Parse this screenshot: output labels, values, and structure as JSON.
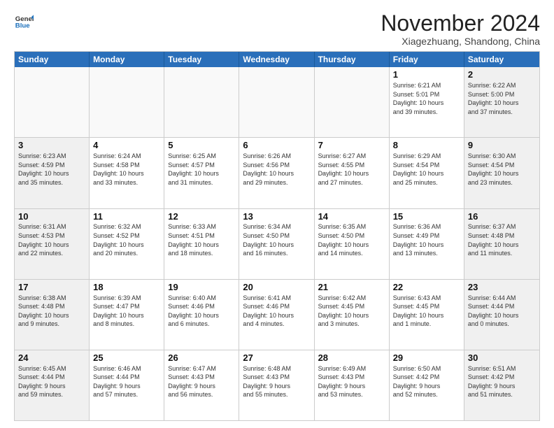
{
  "header": {
    "logo_general": "General",
    "logo_blue": "Blue",
    "month_title": "November 2024",
    "location": "Xiagezhuang, Shandong, China"
  },
  "weekdays": [
    "Sunday",
    "Monday",
    "Tuesday",
    "Wednesday",
    "Thursday",
    "Friday",
    "Saturday"
  ],
  "rows": [
    [
      {
        "day": "",
        "info": "",
        "empty": true
      },
      {
        "day": "",
        "info": "",
        "empty": true
      },
      {
        "day": "",
        "info": "",
        "empty": true
      },
      {
        "day": "",
        "info": "",
        "empty": true
      },
      {
        "day": "",
        "info": "",
        "empty": true
      },
      {
        "day": "1",
        "info": "Sunrise: 6:21 AM\nSunset: 5:01 PM\nDaylight: 10 hours\nand 39 minutes."
      },
      {
        "day": "2",
        "info": "Sunrise: 6:22 AM\nSunset: 5:00 PM\nDaylight: 10 hours\nand 37 minutes."
      }
    ],
    [
      {
        "day": "3",
        "info": "Sunrise: 6:23 AM\nSunset: 4:59 PM\nDaylight: 10 hours\nand 35 minutes."
      },
      {
        "day": "4",
        "info": "Sunrise: 6:24 AM\nSunset: 4:58 PM\nDaylight: 10 hours\nand 33 minutes."
      },
      {
        "day": "5",
        "info": "Sunrise: 6:25 AM\nSunset: 4:57 PM\nDaylight: 10 hours\nand 31 minutes."
      },
      {
        "day": "6",
        "info": "Sunrise: 6:26 AM\nSunset: 4:56 PM\nDaylight: 10 hours\nand 29 minutes."
      },
      {
        "day": "7",
        "info": "Sunrise: 6:27 AM\nSunset: 4:55 PM\nDaylight: 10 hours\nand 27 minutes."
      },
      {
        "day": "8",
        "info": "Sunrise: 6:29 AM\nSunset: 4:54 PM\nDaylight: 10 hours\nand 25 minutes."
      },
      {
        "day": "9",
        "info": "Sunrise: 6:30 AM\nSunset: 4:54 PM\nDaylight: 10 hours\nand 23 minutes."
      }
    ],
    [
      {
        "day": "10",
        "info": "Sunrise: 6:31 AM\nSunset: 4:53 PM\nDaylight: 10 hours\nand 22 minutes."
      },
      {
        "day": "11",
        "info": "Sunrise: 6:32 AM\nSunset: 4:52 PM\nDaylight: 10 hours\nand 20 minutes."
      },
      {
        "day": "12",
        "info": "Sunrise: 6:33 AM\nSunset: 4:51 PM\nDaylight: 10 hours\nand 18 minutes."
      },
      {
        "day": "13",
        "info": "Sunrise: 6:34 AM\nSunset: 4:50 PM\nDaylight: 10 hours\nand 16 minutes."
      },
      {
        "day": "14",
        "info": "Sunrise: 6:35 AM\nSunset: 4:50 PM\nDaylight: 10 hours\nand 14 minutes."
      },
      {
        "day": "15",
        "info": "Sunrise: 6:36 AM\nSunset: 4:49 PM\nDaylight: 10 hours\nand 13 minutes."
      },
      {
        "day": "16",
        "info": "Sunrise: 6:37 AM\nSunset: 4:48 PM\nDaylight: 10 hours\nand 11 minutes."
      }
    ],
    [
      {
        "day": "17",
        "info": "Sunrise: 6:38 AM\nSunset: 4:48 PM\nDaylight: 10 hours\nand 9 minutes."
      },
      {
        "day": "18",
        "info": "Sunrise: 6:39 AM\nSunset: 4:47 PM\nDaylight: 10 hours\nand 8 minutes."
      },
      {
        "day": "19",
        "info": "Sunrise: 6:40 AM\nSunset: 4:46 PM\nDaylight: 10 hours\nand 6 minutes."
      },
      {
        "day": "20",
        "info": "Sunrise: 6:41 AM\nSunset: 4:46 PM\nDaylight: 10 hours\nand 4 minutes."
      },
      {
        "day": "21",
        "info": "Sunrise: 6:42 AM\nSunset: 4:45 PM\nDaylight: 10 hours\nand 3 minutes."
      },
      {
        "day": "22",
        "info": "Sunrise: 6:43 AM\nSunset: 4:45 PM\nDaylight: 10 hours\nand 1 minute."
      },
      {
        "day": "23",
        "info": "Sunrise: 6:44 AM\nSunset: 4:44 PM\nDaylight: 10 hours\nand 0 minutes."
      }
    ],
    [
      {
        "day": "24",
        "info": "Sunrise: 6:45 AM\nSunset: 4:44 PM\nDaylight: 9 hours\nand 59 minutes."
      },
      {
        "day": "25",
        "info": "Sunrise: 6:46 AM\nSunset: 4:44 PM\nDaylight: 9 hours\nand 57 minutes."
      },
      {
        "day": "26",
        "info": "Sunrise: 6:47 AM\nSunset: 4:43 PM\nDaylight: 9 hours\nand 56 minutes."
      },
      {
        "day": "27",
        "info": "Sunrise: 6:48 AM\nSunset: 4:43 PM\nDaylight: 9 hours\nand 55 minutes."
      },
      {
        "day": "28",
        "info": "Sunrise: 6:49 AM\nSunset: 4:43 PM\nDaylight: 9 hours\nand 53 minutes."
      },
      {
        "day": "29",
        "info": "Sunrise: 6:50 AM\nSunset: 4:42 PM\nDaylight: 9 hours\nand 52 minutes."
      },
      {
        "day": "30",
        "info": "Sunrise: 6:51 AM\nSunset: 4:42 PM\nDaylight: 9 hours\nand 51 minutes."
      }
    ]
  ]
}
